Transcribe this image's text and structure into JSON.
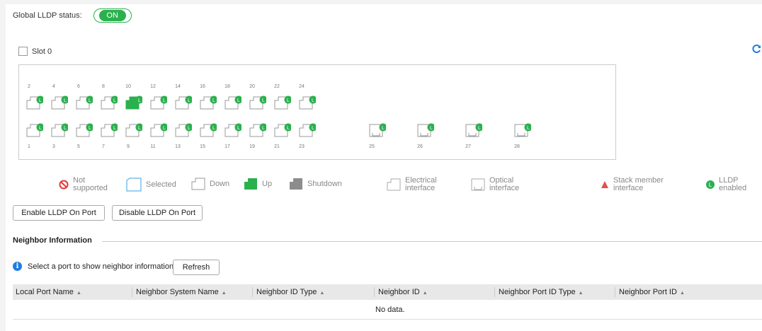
{
  "global": {
    "label": "Global LLDP status:",
    "toggle_value": "ON"
  },
  "slot": {
    "label": "Slot 0"
  },
  "ports": {
    "top_row": [
      "2",
      "4",
      "6",
      "8",
      "10",
      "12",
      "14",
      "16",
      "18",
      "20",
      "22",
      "24"
    ],
    "bottom_row": [
      "1",
      "3",
      "5",
      "7",
      "9",
      "11",
      "13",
      "15",
      "17",
      "19",
      "21",
      "23"
    ],
    "optical": [
      "25",
      "26",
      "27",
      "28"
    ],
    "up_port": "10",
    "lldp_badge": "L"
  },
  "legend": {
    "not_supported": "Not supported",
    "selected": "Selected",
    "down": "Down",
    "up": "Up",
    "shutdown": "Shutdown",
    "electrical": "Electrical interface",
    "optical": "Optical interface",
    "stack": "Stack member interface",
    "lldp": "LLDP enabled"
  },
  "buttons": {
    "enable": "Enable LLDP On Port",
    "disable": "Disable LLDP On Port",
    "refresh": "Refresh"
  },
  "neighbor": {
    "title": "Neighbor Information",
    "hint": "Select a port to show neighbor information.",
    "columns": [
      "Local Port Name",
      "Neighbor System Name",
      "Neighbor ID Type",
      "Neighbor ID",
      "Neighbor Port ID Type",
      "Neighbor Port ID"
    ],
    "empty": "No data."
  },
  "colors": {
    "green": "#2bb04e",
    "red": "#e03c3c",
    "blue": "#1f7de0",
    "gray": "#8c8c8c"
  }
}
